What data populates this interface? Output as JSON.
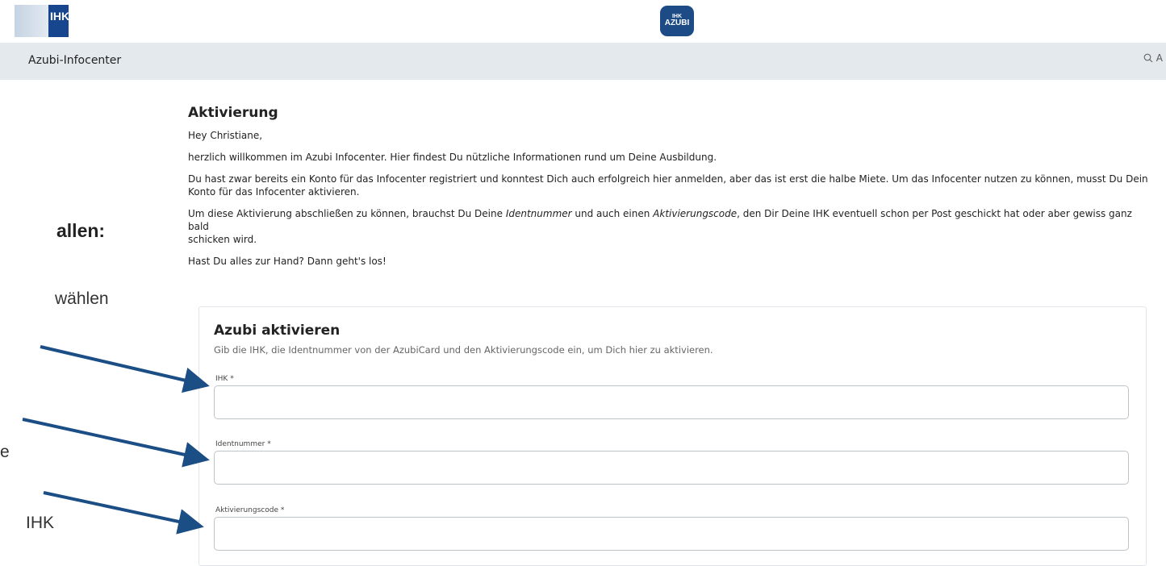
{
  "header": {
    "ihk_logo_text": "IHK",
    "azubi_logo_line1": "IHK",
    "azubi_logo_line2": "AZUBI"
  },
  "navbar": {
    "title": "Azubi-Infocenter",
    "search_fragment": "A"
  },
  "slide_fragments": {
    "bold_line": "allen:",
    "line1": "wählen",
    "line2": "e",
    "line3": "IHK"
  },
  "page": {
    "title": "Aktivierung",
    "greeting": "Hey Christiane,",
    "welcome": "herzlich willkommen im Azubi Infocenter. Hier findest Du nützliche Informationen rund um Deine Ausbildung.",
    "info_line1": "Du hast zwar bereits ein Konto für das Infocenter registriert und konntest Dich auch erfolgreich hier anmelden, aber das ist erst die halbe Miete. Um das Infocenter nutzen zu können, musst Du Dein",
    "info_line2": "Konto für das Infocenter aktivieren.",
    "activation_pre": "Um diese Aktivierung abschließen zu können, brauchst Du Deine ",
    "activation_ident": "Identnummer",
    "activation_mid": " und auch einen ",
    "activation_code": "Aktivierungscode",
    "activation_post": ", den Dir Deine IHK eventuell schon per Post geschickt hat oder aber gewiss ganz bald",
    "activation_line2": "schicken wird.",
    "ready": "Hast Du alles zur Hand? Dann geht's los!"
  },
  "form": {
    "title": "Azubi aktivieren",
    "subtitle": "Gib die IHK, die Identnummer von der AzubiCard und den Aktivierungscode ein, um Dich hier zu aktivieren.",
    "fields": [
      {
        "label": "IHK",
        "required_mark": "*",
        "value": ""
      },
      {
        "label": "Identnummer",
        "required_mark": "*",
        "value": ""
      },
      {
        "label": "Aktivierungscode",
        "required_mark": "*",
        "value": ""
      }
    ]
  },
  "colors": {
    "brand_blue": "#17468f",
    "navbar_bg": "#e4e9ee",
    "arrow": "#1c4e86"
  }
}
